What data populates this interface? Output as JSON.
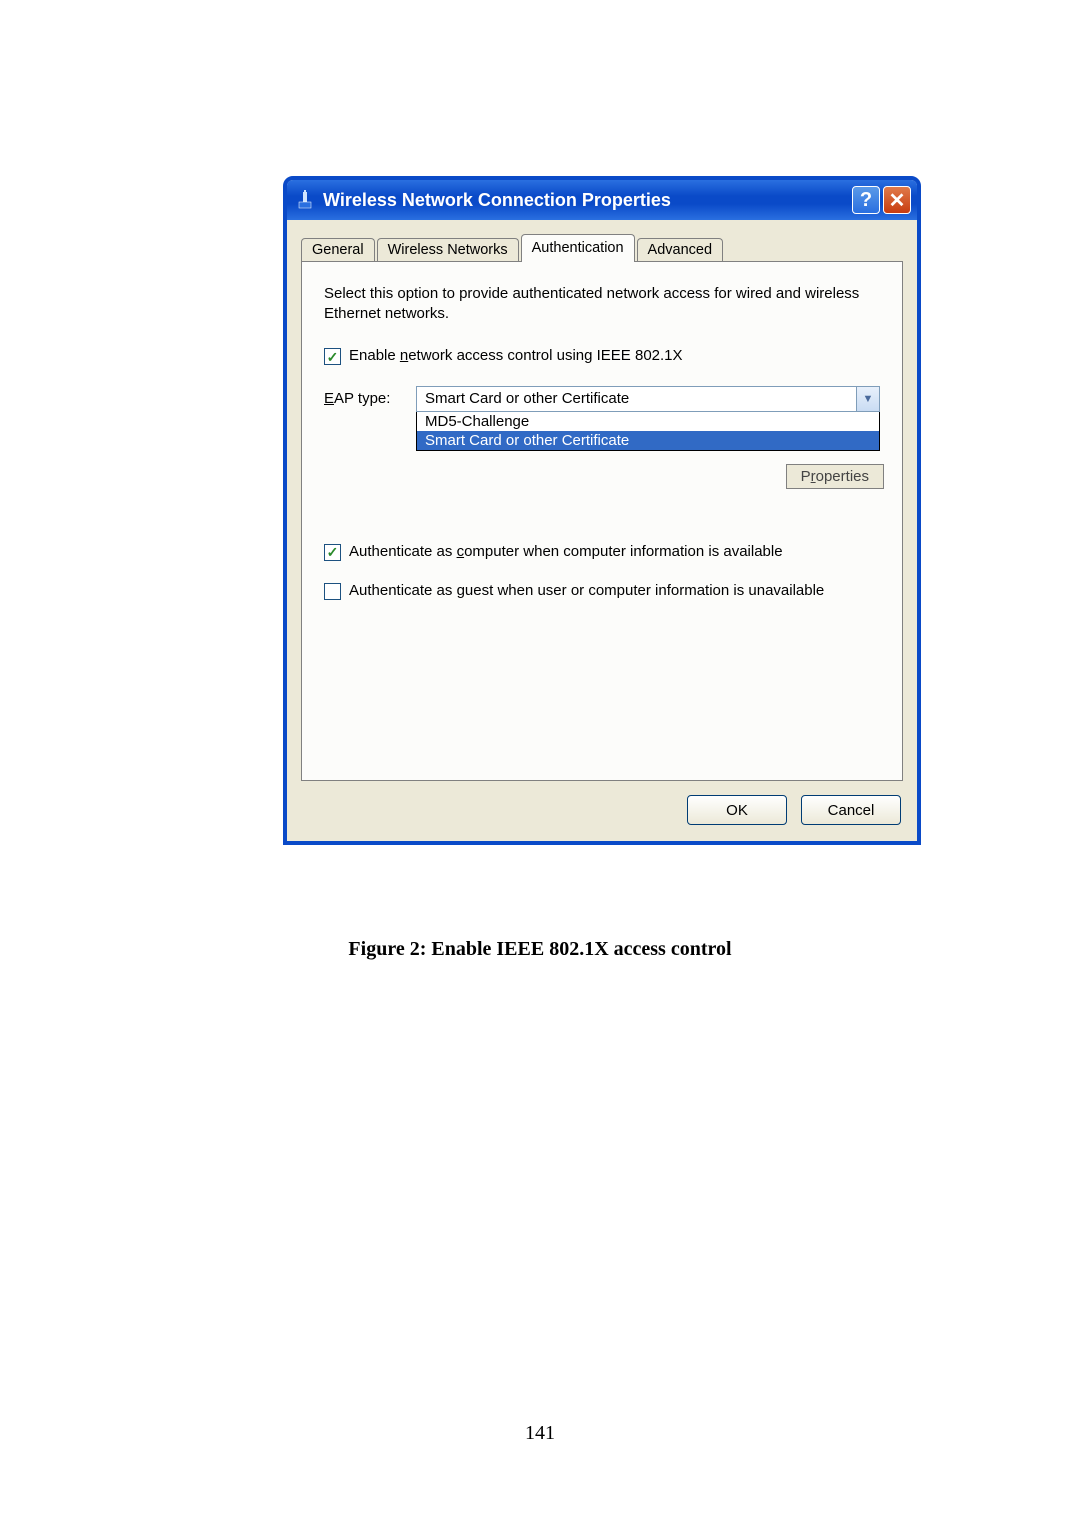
{
  "window": {
    "title": "Wireless Network Connection Properties",
    "help_label": "?",
    "close_label": "✕"
  },
  "tabs": {
    "general": "General",
    "wireless": "Wireless Networks",
    "auth": "Authentication",
    "advanced": "Advanced"
  },
  "panel": {
    "description": "Select this option to provide authenticated network access for wired and wireless Ethernet networks.",
    "enable_label_pre": "Enable ",
    "enable_label_u": "n",
    "enable_label_post": "etwork access control using IEEE 802.1X",
    "eap_label_pre": "E",
    "eap_label_post": "AP type:",
    "eap_selected": "Smart Card or other Certificate",
    "eap_options": {
      "md5": "MD5-Challenge",
      "smart": "Smart Card or other Certificate"
    },
    "properties_pre": "P",
    "properties_u": "r",
    "properties_post": "operties",
    "auth_computer_pre": "Authenticate as ",
    "auth_computer_u": "c",
    "auth_computer_post": "omputer when computer information is available",
    "auth_guest_pre": "Authenticate as ",
    "auth_guest_u": "g",
    "auth_guest_post": "uest when user or computer information is unavailable"
  },
  "buttons": {
    "ok": "OK",
    "cancel": "Cancel"
  },
  "caption": "Figure 2: Enable IEEE 802.1X access control",
  "page_number": "141"
}
